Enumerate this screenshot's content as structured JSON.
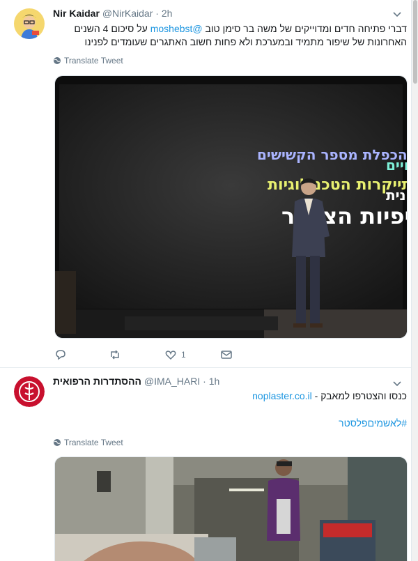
{
  "tweets": [
    {
      "author": {
        "name": "Nir Kaidar",
        "handle": "@NirKaidar",
        "time": "2h"
      },
      "text_part1": "דברי פתיחה חדים ומדוייקים של משה בר סימן טוב",
      "mention": "@moshebst",
      "text_part2": "על סיכום 4 השנים האחרונות של שיפור מתמיד ובמערכת ולא פחות חשוב האתגרים שעומדים לפנינו",
      "translate_label": "Translate Tweet",
      "slide_lines": [
        "עליה בתוחלת החיים",
        "הכפלת מספר הקשישים",
        "עליה בתחלואה הכרונית",
        "התייקרות הטכנולוגיות",
        "בציפיות הציבור"
      ],
      "slide_colors": [
        "#7ef0d8",
        "#aab4ff",
        "#ffffff",
        "#e8f070",
        "#ffffff"
      ],
      "actions": {
        "reply_count": "",
        "retweet_count": "",
        "like_count": "1"
      }
    },
    {
      "author": {
        "name": "ההסתדרות הרפואית",
        "handle": "@IMA_HARI",
        "time": "1h"
      },
      "text": "כנסו והצטרפו למאבק -",
      "link": "noplaster.co.il",
      "hashtag": "#לאשמיםפלסטר",
      "translate_label": "Translate Tweet"
    }
  ],
  "colors": {
    "accent": "#1b95e0",
    "muted": "#657786",
    "text": "#14171a",
    "ima_red": "#c8102e"
  },
  "icons": [
    "reply-icon",
    "retweet-icon",
    "like-icon",
    "dm-icon",
    "globe-icon",
    "chevron-down-icon"
  ]
}
